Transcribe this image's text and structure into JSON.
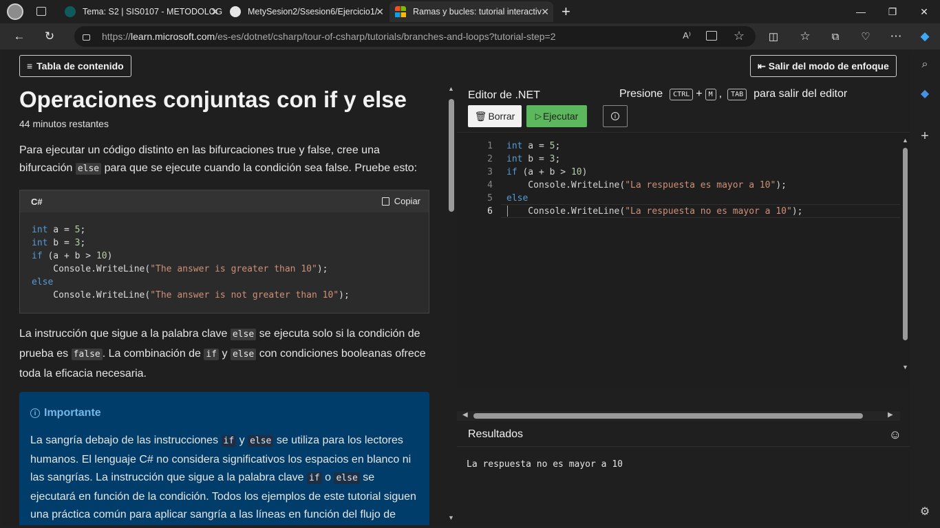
{
  "browser": {
    "tabs": [
      {
        "title": "Tema: S2 | SIS0107 - METODOLOG",
        "active": false
      },
      {
        "title": "MetySesion2/Ssesion6/Ejercicio1/",
        "active": false
      },
      {
        "title": "Ramas y bucles: tutorial interactiv",
        "active": true
      }
    ],
    "url_prefix": "https://",
    "url_host": "learn.microsoft.com",
    "url_path": "/es-es/dotnet/csharp/tour-of-csharp/tutorials/branches-and-loops?tutorial-step=2",
    "new_tab": "+"
  },
  "page": {
    "toc_button": "Tabla de contenido",
    "exit_focus_button": "Salir del modo de enfoque",
    "title": "Operaciones conjuntas con if y else",
    "time_remaining": "44 minutos restantes",
    "intro_1": "Para ejecutar un código distinto en las bifurcaciones true y false, cree una bifurcación ",
    "intro_code": "else",
    "intro_2": " para que se ejecute cuando la condición sea false. Pruebe esto:",
    "code_lang": "C#",
    "copy_label": "Copiar",
    "code_lines": [
      "int a = 5;",
      "int b = 3;",
      "if (a + b > 10)",
      "    Console.WriteLine(\"The answer is greater than 10\");",
      "else",
      "    Console.WriteLine(\"The answer is not greater than 10\");"
    ],
    "para2_1": "La instrucción que sigue a la palabra clave ",
    "para2_c1": "else",
    "para2_2": " se ejecuta solo si la condición de prueba es ",
    "para2_c2": "false",
    "para2_3": ". La combinación de ",
    "para2_c3": "if",
    "para2_4": " y ",
    "para2_c4": "else",
    "para2_5": " con condiciones booleanas ofrece toda la eficacia necesaria.",
    "note_title": "Importante",
    "note_1": "La sangría debajo de las instrucciones ",
    "note_c1": "if",
    "note_2": " y ",
    "note_c2": "else",
    "note_3": " se utiliza para los lectores humanos. El lenguaje C# no considera significativos los espacios en blanco ni las sangrías. La instrucción que sigue a la palabra clave ",
    "note_c3": "if",
    "note_4": " o ",
    "note_c4": "else",
    "note_5": " se ejecutará en función de la condición. Todos los ejemplos de este tutorial siguen una práctica común para aplicar sangría a las líneas en función del flujo de control"
  },
  "editor": {
    "title": "Editor de .NET",
    "hint_prefix": "Presione",
    "key_ctrl": "CTRL",
    "key_plus": "+",
    "key_m": "M",
    "key_comma": ",",
    "key_tab": "TAB",
    "hint_suffix": "para salir del editor",
    "clear_button": "Borrar",
    "run_button": "Ejecutar",
    "line_numbers": [
      "1",
      "2",
      "3",
      "4",
      "5",
      "6"
    ],
    "lines": [
      "int a = 5;",
      "int b = 3;",
      "if (a + b > 10)",
      "    Console.WriteLine(\"La respuesta es mayor a 10\");",
      "else",
      "    Console.WriteLine(\"La respuesta no es mayor a 10\");"
    ],
    "results_title": "Resultados",
    "output": "La respuesta no es mayor a 10"
  },
  "colors": {
    "run_button": "#5cb85c",
    "note_background": "#003d6b",
    "keyword": "#569cd6",
    "string": "#ce9178"
  }
}
